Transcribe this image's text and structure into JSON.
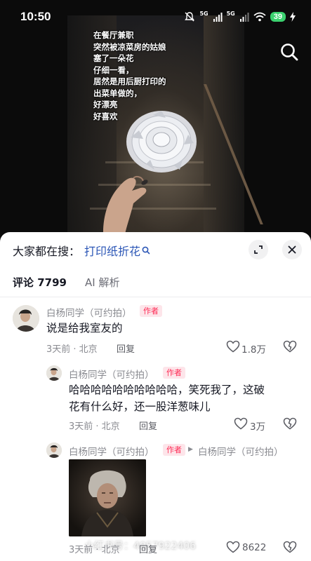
{
  "status_bar": {
    "time": "10:50",
    "signal_1": "5G",
    "signal_2": "5G",
    "battery": "39"
  },
  "video": {
    "caption_lines": [
      "在餐厅兼职",
      "突然被凉菜房的姑娘",
      "塞了一朵花",
      "仔细一看，",
      "居然是用后厨打印的",
      "出菜单做的，",
      "好漂亮",
      "好喜欢"
    ]
  },
  "search_suggest": {
    "prefix": "大家都在搜：",
    "keyword": "打印纸折花"
  },
  "tabs": [
    {
      "label": "评论 7799",
      "active": true
    },
    {
      "label": "AI 解析",
      "active": false
    }
  ],
  "comments": [
    {
      "name": "白杨同学（可约拍）",
      "badge": "作者",
      "text": "说是给我室友的",
      "time_location": "3天前 · 北京",
      "reply_label": "回复",
      "likes": "1.8万"
    },
    {
      "name": "白杨同学（可约拍）",
      "badge": "作者",
      "text_line1": "哈哈哈哈哈哈哈哈哈哈，笑死我了，这破",
      "text_line2": "花有什么好，还一股洋葱味儿",
      "time_location": "3天前 · 北京",
      "reply_label": "回复",
      "likes": "3万"
    },
    {
      "name": "白杨同学（可约拍）",
      "badge": "作者",
      "reply_to": "白杨同学（可约拍）",
      "time_location": "3天前 · 北京",
      "reply_label": "回复",
      "likes": "8622"
    }
  ],
  "watermark": "小红书号：4057922406",
  "colors": {
    "accent_red": "#fe2c55",
    "keyword_blue": "#2b56b6",
    "battery_green": "#3bd16f"
  }
}
